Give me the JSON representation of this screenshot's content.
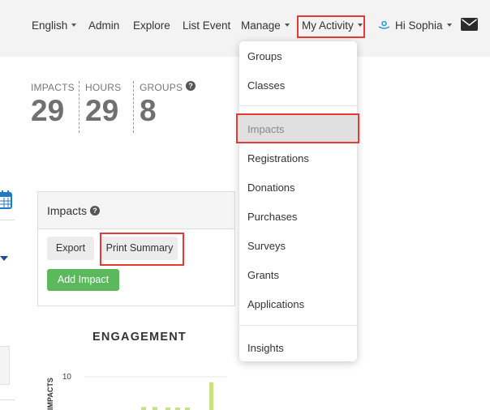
{
  "nav": {
    "language": "English",
    "admin": "Admin",
    "explore": "Explore",
    "list_event": "List Event",
    "manage": "Manage",
    "my_activity": "My Activity",
    "greeting": "Hi Sophia"
  },
  "stats": {
    "impacts_label": "IMPACTS",
    "impacts_value": "29",
    "hours_label": "HOURS",
    "hours_value": "29",
    "groups_label": "GROUPS",
    "groups_value": "8"
  },
  "panel": {
    "title": "Impacts",
    "export_label": "Export",
    "print_summary_label": "Print Summary",
    "add_impact_label": "Add Impact"
  },
  "chart": {
    "title": "ENGAGEMENT",
    "ylabel": "IMPACTS",
    "y_tick": "10"
  },
  "chart_data": {
    "type": "bar",
    "title": "ENGAGEMENT",
    "ylabel": "IMPACTS",
    "y_ticks": [
      10
    ],
    "ylim": [
      0,
      12
    ],
    "categories": [
      "",
      "",
      "",
      "",
      "",
      "",
      ""
    ],
    "values": [
      1,
      1,
      0.5,
      0.5,
      0.5,
      0,
      12
    ],
    "grid": true,
    "color": "#c5e384"
  },
  "dropdown": {
    "items": [
      {
        "label": "Groups"
      },
      {
        "label": "Classes"
      },
      {
        "label": "Impacts",
        "active": true
      },
      {
        "label": "Registrations"
      },
      {
        "label": "Donations"
      },
      {
        "label": "Purchases"
      },
      {
        "label": "Surveys"
      },
      {
        "label": "Grants"
      },
      {
        "label": "Applications"
      },
      {
        "label": "Insights"
      }
    ]
  },
  "colors": {
    "accent_green": "#5cb85c",
    "highlight_red": "#e53935",
    "chart_bar": "#c5e384",
    "user_icon": "#2f9bdc"
  }
}
